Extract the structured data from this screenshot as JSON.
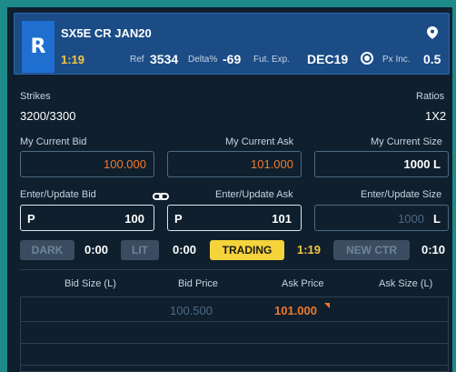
{
  "header": {
    "badge": "R",
    "instrument": "SX5E CR JAN20",
    "time": "1:19",
    "ref_label": "Ref",
    "ref_value": "3534",
    "delta_label": "Delta%",
    "delta_value": "-69",
    "fut_exp_label": "Fut. Exp.",
    "fut_exp_value": "DEC19",
    "px_inc_label": "Px Inc.",
    "px_inc_value": "0.5"
  },
  "strikes": {
    "label": "Strikes",
    "value": "3200/3300"
  },
  "ratios": {
    "label": "Ratios",
    "value": "1X2"
  },
  "current": {
    "bid_label": "My Current Bid",
    "bid_value": "100.000",
    "ask_label": "My Current Ask",
    "ask_value": "101.000",
    "size_label": "My Current Size",
    "size_value": "1000 L"
  },
  "update": {
    "bid_label": "Enter/Update Bid",
    "bid_prefix": "P",
    "bid_value": "100",
    "ask_label": "Enter/Update Ask",
    "ask_prefix": "P",
    "ask_value": "101",
    "size_label": "Enter/Update Size",
    "size_placeholder": "1000",
    "size_unit": "L"
  },
  "status_bar": {
    "dark_label": "DARK",
    "dark_timer": "0:00",
    "lit_label": "LIT",
    "lit_timer": "0:00",
    "trading_label": "TRADING",
    "trading_timer": "1:19",
    "new_ctr_label": "NEW CTR",
    "new_ctr_timer": "0:10"
  },
  "book": {
    "columns": [
      "Bid Size (L)",
      "Bid Price",
      "Ask Price",
      "Ask Size (L)"
    ],
    "rows": [
      {
        "bid_size": "",
        "bid_price": "100.500",
        "ask_price": "101.000",
        "ask_size": ""
      }
    ]
  },
  "colors": {
    "accent": "#1f6fd1",
    "orange": "#f07a2a",
    "yellow": "#f5c542",
    "teal_frame": "#1e8a8a"
  },
  "icons": {
    "location": "map-pin-icon",
    "radio": "radio-selected-icon",
    "link": "link-icon"
  }
}
